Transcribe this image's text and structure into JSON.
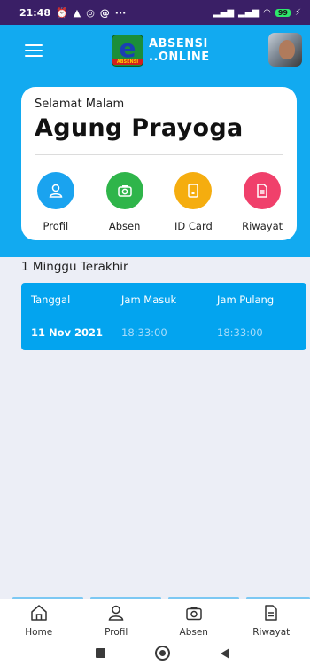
{
  "status_bar": {
    "time": "21:48",
    "left_icons": [
      "alarm-icon",
      "warning-icon",
      "whatsapp-icon",
      "at-icon"
    ],
    "more": "···",
    "battery": "99"
  },
  "header": {
    "menu_icon": "hamburger-menu-icon",
    "logo_badge_text": "ABSENSI",
    "logo_line1": "ABSENSI",
    "logo_line2": "..ONLINE"
  },
  "card": {
    "greeting": "Selamat Malam",
    "user_name": "Agung Prayoga",
    "menu": [
      {
        "label": "Profil",
        "icon": "user-icon",
        "color": "#1aa3ef"
      },
      {
        "label": "Absen",
        "icon": "camera-icon",
        "color": "#2fb54a"
      },
      {
        "label": "ID Card",
        "icon": "id-card-icon",
        "color": "#f5ad0f"
      },
      {
        "label": "Riwayat",
        "icon": "document-icon",
        "color": "#f0406b"
      }
    ]
  },
  "history": {
    "title": "1 Minggu Terakhir",
    "columns": [
      "Tanggal",
      "Jam Masuk",
      "Jam Pulang"
    ],
    "rows": [
      [
        "11 Nov 2021",
        "18:33:00",
        "18:33:00"
      ]
    ]
  },
  "bottom_nav": [
    {
      "label": "Home",
      "icon": "home-icon"
    },
    {
      "label": "Profil",
      "icon": "user-icon"
    },
    {
      "label": "Absen",
      "icon": "camera-icon"
    },
    {
      "label": "Riwayat",
      "icon": "document-icon"
    }
  ],
  "colors": {
    "primary": "#12aaf0",
    "status_bar": "#3a1f66",
    "background": "#eceef6",
    "table": "#03a4ef"
  }
}
